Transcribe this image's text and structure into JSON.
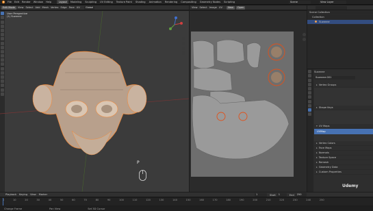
{
  "topbar": {
    "menu": [
      "File",
      "Edit",
      "Render",
      "Window",
      "Help"
    ],
    "workspaces": [
      "Layout",
      "Modeling",
      "Sculpting",
      "UV Editing",
      "Texture Paint",
      "Shading",
      "Animation",
      "Rendering",
      "Compositing",
      "Geometry Nodes",
      "Scripting"
    ],
    "active_workspace": "Layout",
    "scene": "Scene",
    "view_layer": "View Layer"
  },
  "viewport": {
    "mode": "Edit Mode",
    "menus": [
      "View",
      "Select",
      "Add",
      "Mesh",
      "Vertex",
      "Edge",
      "Face",
      "UV"
    ],
    "overlay_title": "User Perspective",
    "overlay_subtitle": "(1) Suzanne",
    "transform_orientation": "Global",
    "key_hint": "P"
  },
  "uv_editor": {
    "menus": [
      "View",
      "Select",
      "Image",
      "UV"
    ],
    "image_new": "New",
    "image_open": "Open"
  },
  "outliner": {
    "title": "Scene Collection",
    "items": [
      "Collection",
      "Suzanne"
    ],
    "search_placeholder": ""
  },
  "properties": {
    "object_name": "Suzanne",
    "mesh_name": "Suzanne.001",
    "sections": [
      "Vertex Groups",
      "Shape Keys",
      "UV Maps"
    ],
    "uvmap_entry": "UVMap",
    "subsections": [
      "Vertex Colors",
      "Face Maps",
      "Normals",
      "Texture Space",
      "Remesh",
      "Geometry Data",
      "Custom Properties"
    ]
  },
  "timeline": {
    "menus": [
      "Playback",
      "Keying",
      "View",
      "Marker"
    ],
    "frame_start_label": "Start",
    "frame_start": "1",
    "frame_end_label": "End",
    "frame_end": "250",
    "current_frame": "1",
    "ticks": [
      "0",
      "10",
      "20",
      "30",
      "40",
      "50",
      "60",
      "70",
      "80",
      "90",
      "100",
      "110",
      "120",
      "130",
      "140",
      "150",
      "160",
      "170",
      "180",
      "190",
      "200",
      "210",
      "220",
      "230",
      "240",
      "250"
    ]
  },
  "statusbar": {
    "left": "Change Frame",
    "middle": "Pan View",
    "right": "Set 3D Cursor"
  },
  "watermark": "Udemy",
  "colors": {
    "accent": "#4772b3",
    "selected_edge": "#f08a3c",
    "uv_grid_bg": "#6e6e6e",
    "uv_island": "#9a9a9a"
  }
}
